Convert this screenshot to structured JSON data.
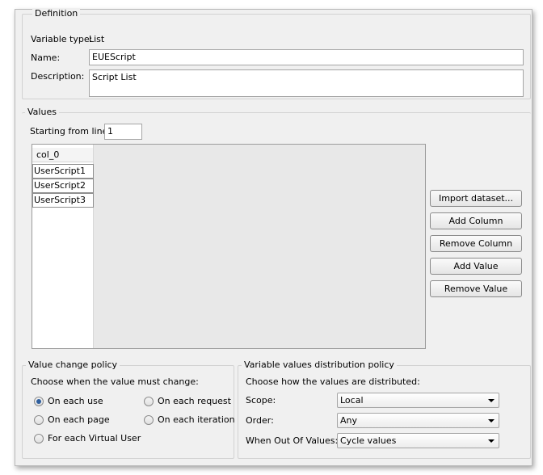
{
  "definition": {
    "title": "Definition",
    "variable_type_label": "Variable type:",
    "variable_type_value": "List",
    "name_label": "Name:",
    "name_value": "EUEScript",
    "description_label": "Description:",
    "description_value": "Script List"
  },
  "values": {
    "title": "Values",
    "starting_line_label": "Starting from line:",
    "starting_line_value": "1",
    "table": {
      "column_header": "col_0",
      "rows": [
        "UserScript1",
        "UserScript2",
        "UserScript3"
      ]
    },
    "buttons": {
      "import_dataset": "Import dataset...",
      "add_column": "Add Column",
      "remove_column": "Remove Column",
      "add_value": "Add Value",
      "remove_value": "Remove Value"
    }
  },
  "value_change_policy": {
    "title": "Value change policy",
    "prompt": "Choose when the value must change:",
    "options": {
      "each_use": "On each use",
      "each_request": "On each request",
      "each_page": "On each page",
      "each_iteration": "On each iteration",
      "each_virtual_user": "For each Virtual User"
    },
    "selected": "each_use"
  },
  "distribution_policy": {
    "title": "Variable values distribution policy",
    "prompt": "Choose how the values are distributed:",
    "scope_label": "Scope:",
    "scope_value": "Local",
    "order_label": "Order:",
    "order_value": "Any",
    "out_of_values_label": "When Out Of Values:",
    "out_of_values_value": "Cycle values"
  }
}
